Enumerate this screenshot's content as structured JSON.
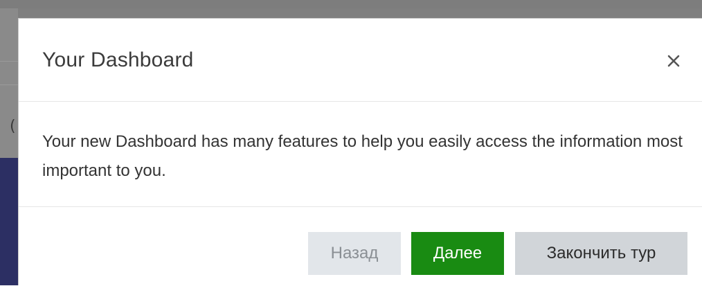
{
  "dialog": {
    "title": "Your Dashboard",
    "body_text": "Your new Dashboard has many features to help you easily access the information most important to you.",
    "close_icon": "close-icon"
  },
  "backdrop": {
    "edge_glyph": "("
  },
  "footer": {
    "back_label": "Назад",
    "next_label": "Далее",
    "end_tour_label": "Закончить тур"
  },
  "colors": {
    "next_button_bg": "#198b12",
    "back_button_bg": "#e2e6ea",
    "end_button_bg": "#d1d5d9",
    "backdrop": "#7f7f7f"
  }
}
